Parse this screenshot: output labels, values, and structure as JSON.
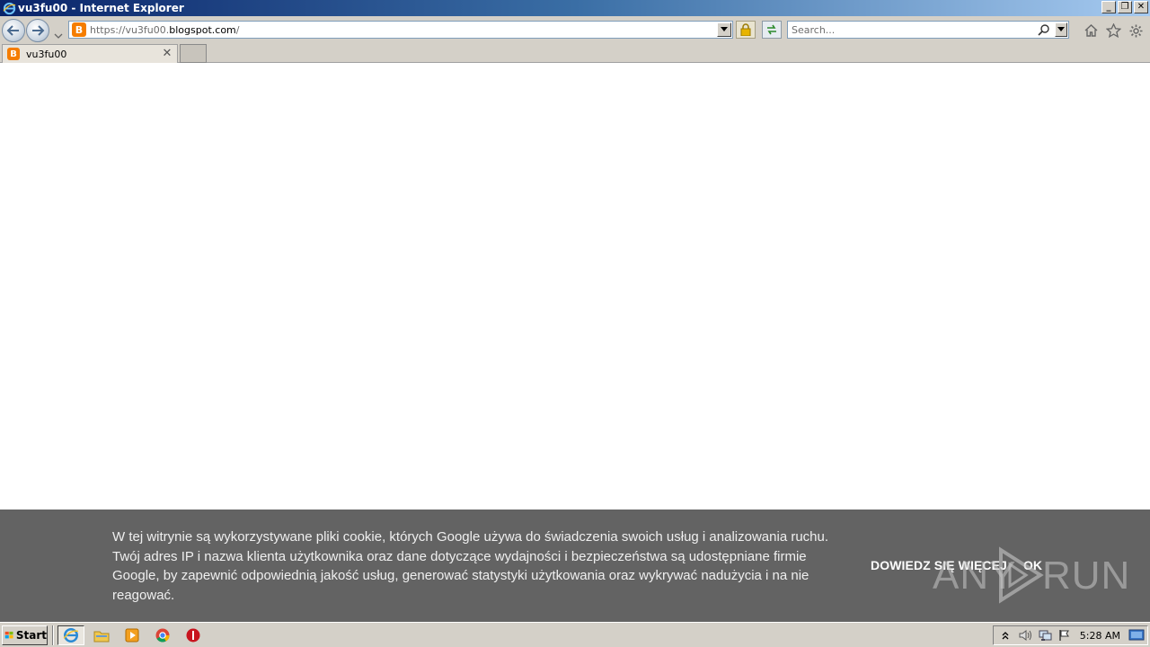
{
  "window": {
    "title": "vu3fu00 - Internet Explorer",
    "app_icon": "ie-icon",
    "controls": [
      "minimize-icon",
      "restore-icon",
      "close-icon"
    ]
  },
  "navbar": {
    "back_icon": "back-arrow-icon",
    "forward_icon": "forward-arrow-icon",
    "address": {
      "favicon": "blogger-icon",
      "url_prefix": "https://",
      "url_sub": "vu3fu00.",
      "url_domain": "blogspot.com",
      "url_path": "/"
    },
    "lock_icon": "padlock-icon",
    "refresh_icon": "refresh-icon",
    "search_placeholder": "Search...",
    "tools": [
      "home-icon",
      "star-icon",
      "gear-icon"
    ]
  },
  "tabs": [
    {
      "label": "vu3fu00",
      "favicon": "blogger-icon",
      "close_icon": "close-icon"
    }
  ],
  "cookie_banner": {
    "text": "W tej witrynie są wykorzystywane pliki cookie, których Google używa do świadczenia swoich usług i analizowania ruchu. Twój adres IP i nazwa klienta użytkownika oraz dane dotyczące wydajności i bezpieczeństwa są udostępniane firmie Google, by zapewnić odpowiednią jakość usług, generować statystyki użytkowania oraz wykrywać nadużycia i na nie reagować.",
    "learn_more": "DOWIEDZ SIĘ WIĘCEJ",
    "ok": "OK"
  },
  "watermark": {
    "left": "ANY",
    "right": "RUN"
  },
  "taskbar": {
    "start_label": "Start",
    "apps": [
      "ie-icon",
      "folder-icon",
      "media-player-icon",
      "chrome-icon",
      "stop-icon"
    ],
    "tray_icons": [
      "tray-arrow-icon",
      "speaker-icon",
      "network-icon",
      "flag-icon"
    ],
    "clock": "5:28 AM"
  },
  "colors": {
    "chrome": "#d4d0c8",
    "banner": "#636363",
    "blogger": "#f57d00"
  }
}
